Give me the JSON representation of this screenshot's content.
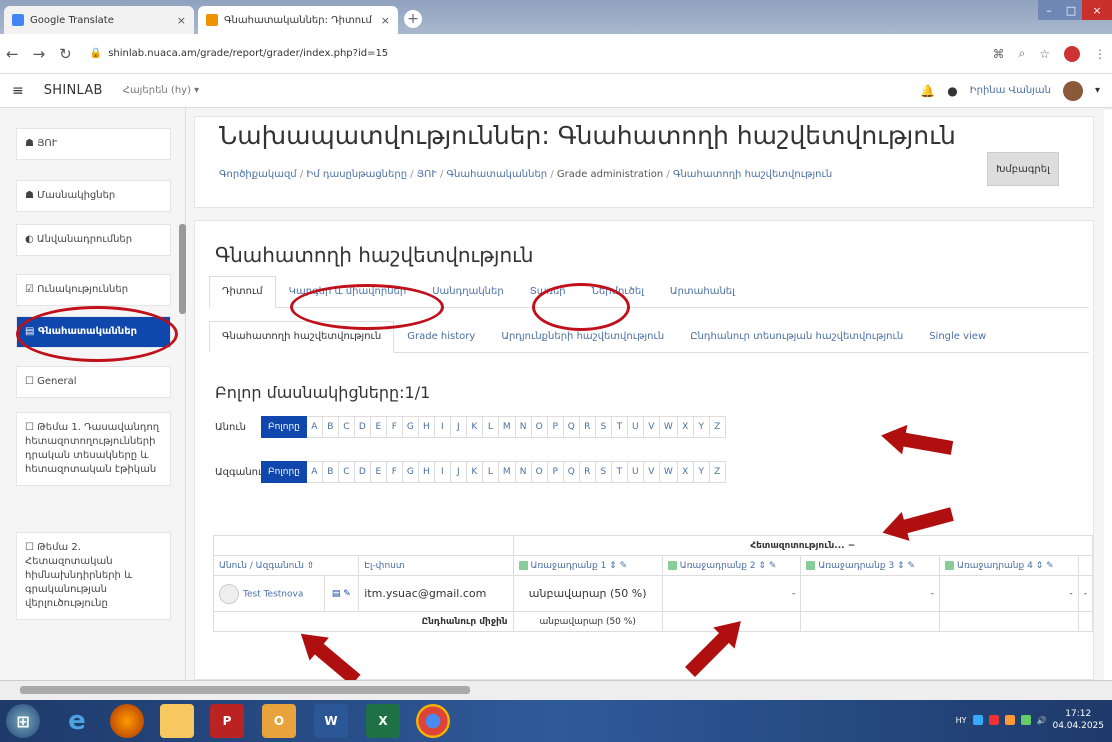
{
  "browser": {
    "tabs": [
      {
        "title": "Google Translate",
        "close": "×"
      },
      {
        "title": "Գնահատականներ: Դիտում",
        "close": "×"
      }
    ],
    "new_tab": "+",
    "url": "shinlab.nuaca.am/grade/report/grader/index.php?id=15",
    "window_controls": [
      "–",
      "□",
      "×"
    ]
  },
  "navbar": {
    "brand": "SHINLAB",
    "language": "Հայերեն (hy) ▾",
    "user": "Իրինա Վանյան",
    "menu_caret": "▾"
  },
  "sidebar": {
    "items": [
      {
        "icon": "☗",
        "label": "ՅՈՒ"
      },
      {
        "icon": "☗",
        "label": "Մասնակիցներ"
      },
      {
        "icon": "◐",
        "label": "Անվանադրումներ"
      },
      {
        "icon": "☑",
        "label": "Ունակություններ"
      },
      {
        "icon": "▤",
        "label": "Գնահատականներ"
      },
      {
        "icon": "☐",
        "label": "General"
      },
      {
        "icon": "☐",
        "label": "Թեմա 1. Դասավանդող հետազոտողությունների դրական տեսակները և հետազոտական էթիկան"
      },
      {
        "icon": "☐",
        "label": "Թեմա 2. Հետազոտական հիմնախնդիրների և գրականության վերլուծությունը"
      }
    ]
  },
  "header": {
    "title": "Նախապատվություններ: Գնահատողի հաշվետվություն",
    "breadcrumb": [
      "Գործիքակազմ",
      "Իմ դասընթացները",
      "ՅՈՒ",
      "Գնահատականներ",
      "Grade administration",
      "Գնահատողի հաշվետվություն"
    ],
    "edit_button": "Խմբագրել"
  },
  "section": {
    "title": "Գնահատողի հաշվետվություն",
    "tabs": [
      "Դիտում",
      "Կարգեր և միավորներ",
      "Սանդղակներ",
      "Տառեր",
      "Ներմուծել",
      "Արտահանել"
    ],
    "subtabs": [
      "Գնահատողի հաշվետվություն",
      "Grade history",
      "Արդյունքների հաշվետվություն",
      "Ընդհանուր տեսության հաշվետվություն",
      "Single view"
    ],
    "participants": "Բոլոր մասնակիցները:1/1"
  },
  "filters": {
    "first_name_label": "Անուն",
    "last_name_label": "Ազգանուն",
    "all_label": "Բոլորը",
    "letters": [
      "A",
      "B",
      "C",
      "D",
      "E",
      "F",
      "G",
      "H",
      "I",
      "J",
      "K",
      "L",
      "M",
      "N",
      "O",
      "P",
      "Q",
      "R",
      "S",
      "T",
      "U",
      "V",
      "W",
      "X",
      "Y",
      "Z"
    ]
  },
  "table": {
    "category_title": "Հետազոտություն...",
    "category_toggle": "−",
    "col_name": "Անուն / Ազգանուն",
    "col_sort": "⇧",
    "col_email": "Էլ-փոստ",
    "col_items": [
      "Առաջադրանք 1 ⇕",
      "Առաջադրանք 2 ⇕",
      "Առաջադրանք 3 ⇕",
      "Առաջադրանք 4 ⇕"
    ],
    "row": {
      "name": "Test Testnova",
      "email": "itm.ysuac@gmail.com",
      "total": "անբավարար (50 %)",
      "values": [
        "-",
        "-",
        "-",
        "-"
      ]
    },
    "average_label": "Ընդհանուր միջին",
    "average_value": "անբավարար (50 %)"
  },
  "taskbar": {
    "clock_time": "17:12",
    "clock_date": "04.04.2025",
    "lang": "HY"
  }
}
